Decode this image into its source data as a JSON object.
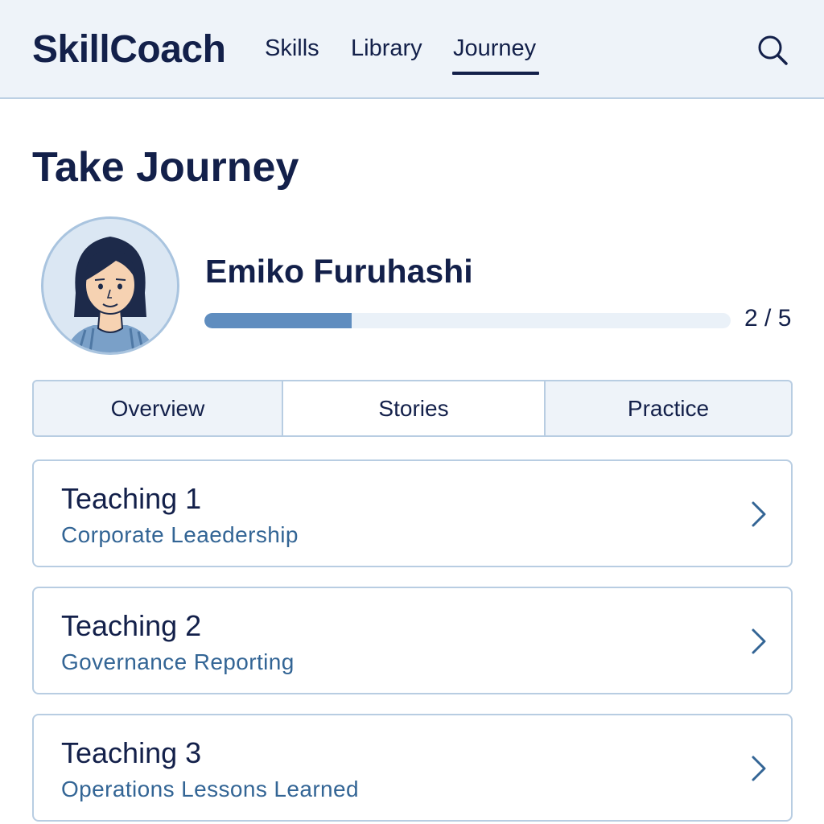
{
  "header": {
    "brand": "SkillCoach",
    "nav": [
      {
        "label": "Skills",
        "active": false
      },
      {
        "label": "Library",
        "active": false
      },
      {
        "label": "Journey",
        "active": true
      }
    ],
    "search_icon": "search-icon"
  },
  "page": {
    "title": "Take Journey"
  },
  "profile": {
    "name": "Emiko Furuhashi",
    "avatar_icon": "person-avatar",
    "progress": {
      "current": 2,
      "total": 5,
      "label": "2 / 5",
      "fraction": 0.28
    }
  },
  "tabs": [
    {
      "label": "Overview",
      "selected": false
    },
    {
      "label": "Stories",
      "selected": true
    },
    {
      "label": "Practice",
      "selected": false
    }
  ],
  "teachings": [
    {
      "title": "Teaching 1",
      "subtitle": "Corporate Leaedership"
    },
    {
      "title": "Teaching 2",
      "subtitle": "Governance Reporting"
    },
    {
      "title": "Teaching 3",
      "subtitle": "Operations Lessons Learned"
    }
  ],
  "colors": {
    "primary_text": "#13204a",
    "accent": "#5f8dbf",
    "subtitle": "#336595",
    "header_bg": "#eef3f9",
    "border": "#b8cde2"
  }
}
